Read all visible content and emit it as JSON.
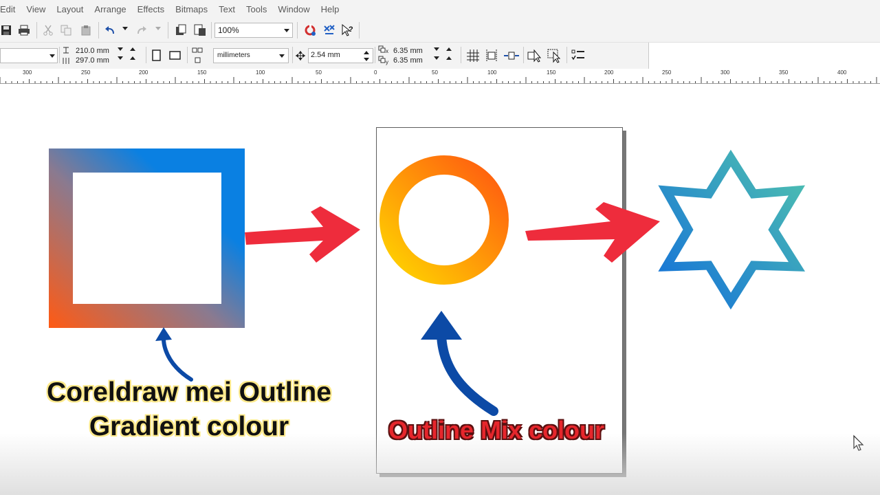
{
  "menu": [
    "Edit",
    "View",
    "Layout",
    "Arrange",
    "Effects",
    "Bitmaps",
    "Text",
    "Tools",
    "Window",
    "Help"
  ],
  "toolbar": {
    "zoom_value": "100%",
    "icons": [
      "save-icon",
      "print-icon",
      "cut-icon",
      "copy-icon",
      "paste-icon",
      "undo-icon",
      "redo-icon",
      "import-icon",
      "export-icon",
      "app-launcher-icon",
      "welcome-icon",
      "help-icon"
    ]
  },
  "property_bar": {
    "page_width": "210.0 mm",
    "page_height": "297.0 mm",
    "units": "millimeters",
    "nudge": "2.54 mm",
    "dup_x_label": "x",
    "dup_x": "6.35 mm",
    "dup_y_label": "y",
    "dup_y": "6.35 mm"
  },
  "ruler": {
    "labels": [
      "300",
      "250",
      "200",
      "150",
      "100",
      "50",
      "0",
      "50",
      "100",
      "150",
      "200",
      "250",
      "300",
      "350",
      "400"
    ]
  },
  "canvas": {
    "caption_left_line1": "Coreldraw mei Outline",
    "caption_left_line2": "Gradient colour",
    "caption_center": "Outline Mix colour"
  },
  "colors": {
    "square_gradient_start": "#ff5a14",
    "square_gradient_end": "#0a80e2",
    "circle_gradient_start": "#ffd400",
    "circle_gradient_end": "#ff5a10",
    "star_gradient_start": "#1572d8",
    "star_gradient_end": "#4ec0b0",
    "red_arrow": "#ee2c3c",
    "blue_arrow": "#0c4aa6"
  }
}
